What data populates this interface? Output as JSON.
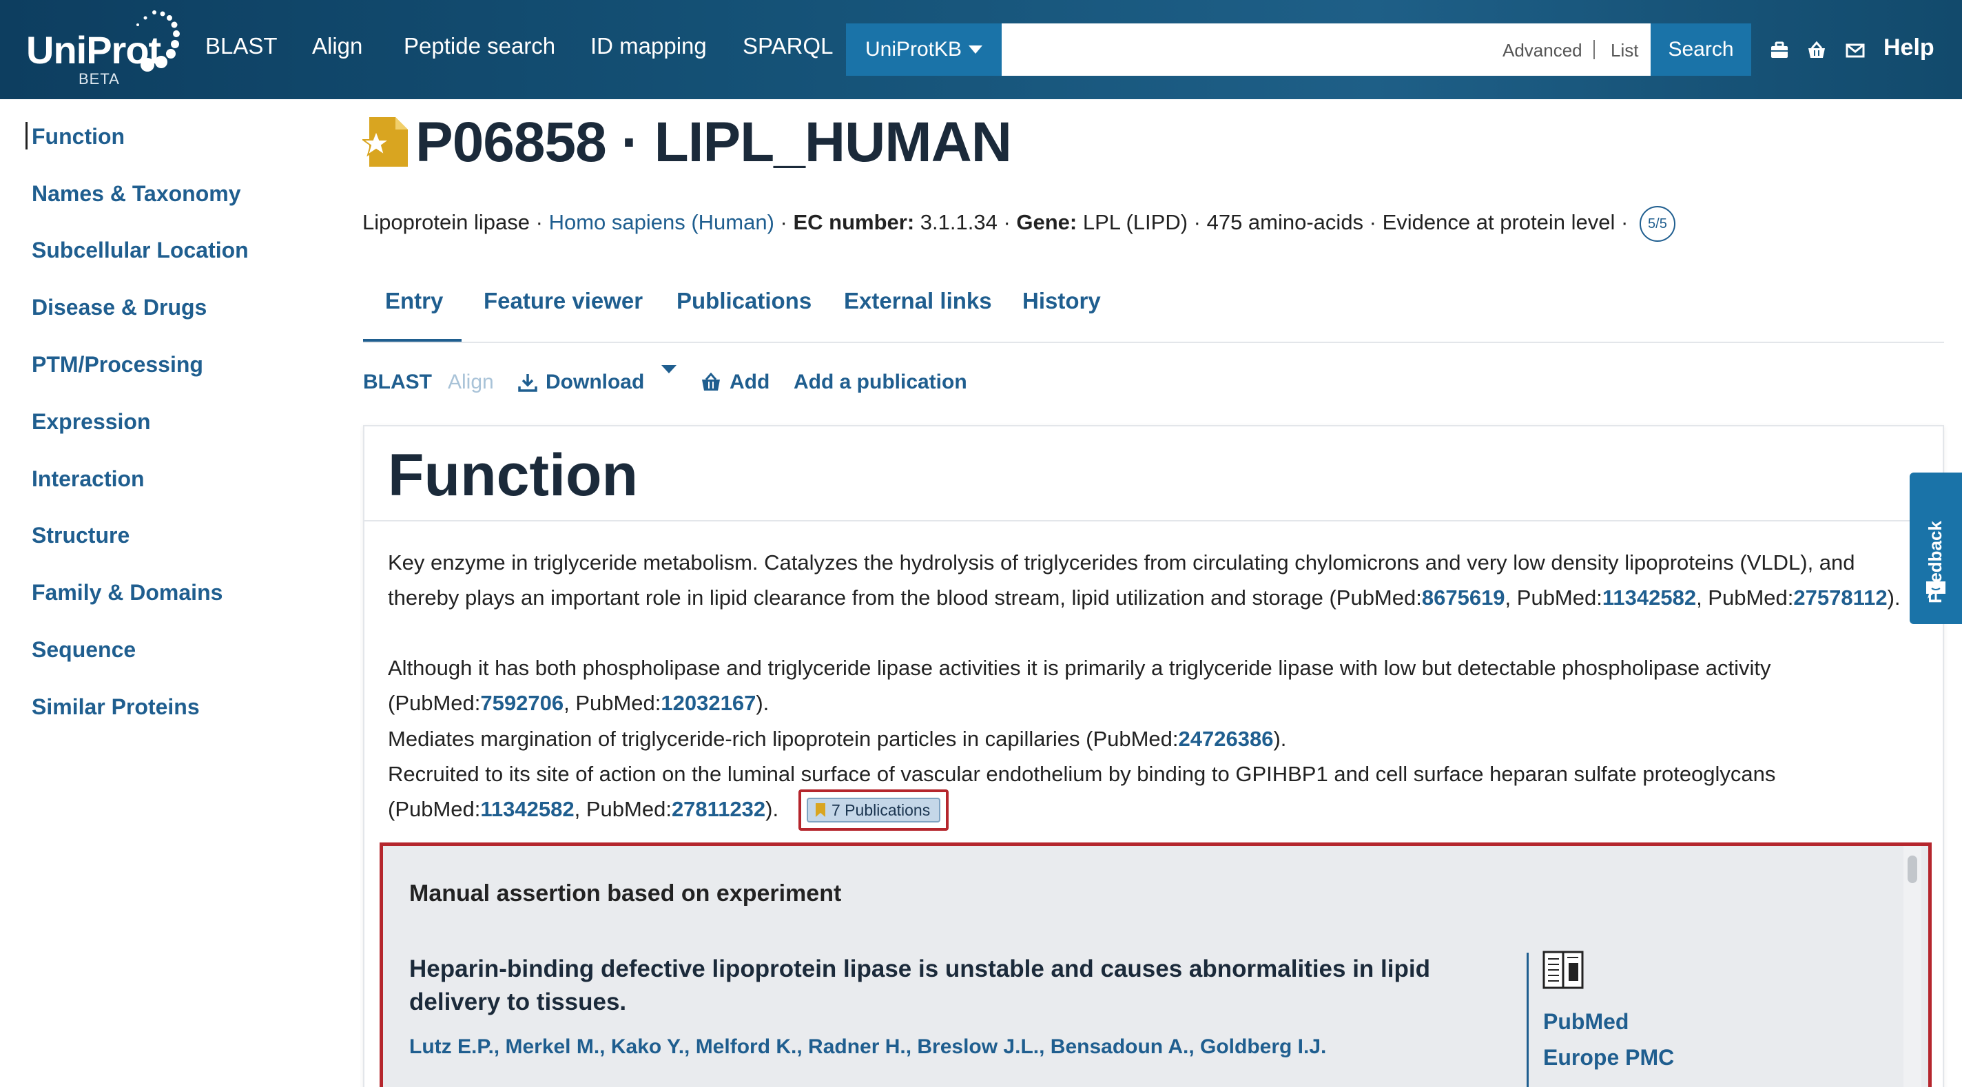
{
  "header": {
    "logo_text": "UniProt",
    "logo_beta": "BETA",
    "nav": [
      "BLAST",
      "Align",
      "Peptide search",
      "ID mapping",
      "SPARQL"
    ],
    "db_select": "UniProtKB",
    "search": {
      "value": "",
      "placeholder": ""
    },
    "advanced_label": "Advanced",
    "list_label": "List",
    "search_button": "Search",
    "help_label": "Help"
  },
  "sidebar": {
    "items": [
      "Function",
      "Names & Taxonomy",
      "Subcellular Location",
      "Disease & Drugs",
      "PTM/Processing",
      "Expression",
      "Interaction",
      "Structure",
      "Family & Domains",
      "Sequence",
      "Similar Proteins"
    ]
  },
  "entry": {
    "title": "P06858 · LIPL_HUMAN",
    "protein": "Lipoprotein lipase · ",
    "organism": "Homo sapiens (Human)",
    "sep1": " · ",
    "ec_label": "EC number:",
    "ec_value": " 3.1.1.34 · ",
    "gene_label": "Gene:",
    "gene_value": " LPL (LIPD) · 475 amino-acids · Evidence at protein level · ",
    "score": "5/5"
  },
  "tabs": [
    "Entry",
    "Feature viewer",
    "Publications",
    "External links",
    "History"
  ],
  "toolbar": {
    "blast": "BLAST",
    "align": "Align",
    "download": "Download",
    "add": "Add",
    "add_publication": "Add a publication"
  },
  "function": {
    "title": "Function",
    "para1_a": "Key enzyme in triglyceride metabolism. Catalyzes the hydrolysis of triglycerides from circulating chylomicrons and very low density lipoproteins (VLDL), and thereby plays an important role in lipid clearance from the blood stream, lipid utilization and storage (PubMed:",
    "para1_l1": "8675619",
    "para1_b": ", PubMed:",
    "para1_l2": "11342582",
    "para1_c": ", PubMed:",
    "para1_l3": "27578112",
    "para1_d": ").",
    "para2_a": "Although it has both phospholipase and triglyceride lipase activities it is primarily a triglyceride lipase with low but detectable phospholipase activity (PubMed:",
    "para2_l1": "7592706",
    "para2_b": ", PubMed:",
    "para2_l2": "12032167",
    "para2_c": ").",
    "para3_a": "Mediates margination of triglyceride-rich lipoprotein particles in capillaries (PubMed:",
    "para3_l1": "24726386",
    "para3_b": ").",
    "para4_a": "Recruited to its site of action on the luminal surface of vascular endothelium by binding to GPIHBP1 and cell surface heparan sulfate proteoglycans (PubMed:",
    "para4_l1": "11342582",
    "para4_b": ", PubMed:",
    "para4_l2": "27811232",
    "para4_c": ").",
    "publications_badge": "7 Publications"
  },
  "evidence": {
    "heading": "Manual assertion based on experiment",
    "article_title": "Heparin-binding defective lipoprotein lipase is unstable and causes abnormalities in lipid delivery to tissues.",
    "authors": "Lutz E.P., Merkel M., Kako Y., Melford K., Radner H., Breslow J.L., Bensadoun A., Goldberg I.J.",
    "pubmed": "PubMed",
    "europe_pmc": "Europe PMC"
  },
  "feedback_label": "Feedback"
}
